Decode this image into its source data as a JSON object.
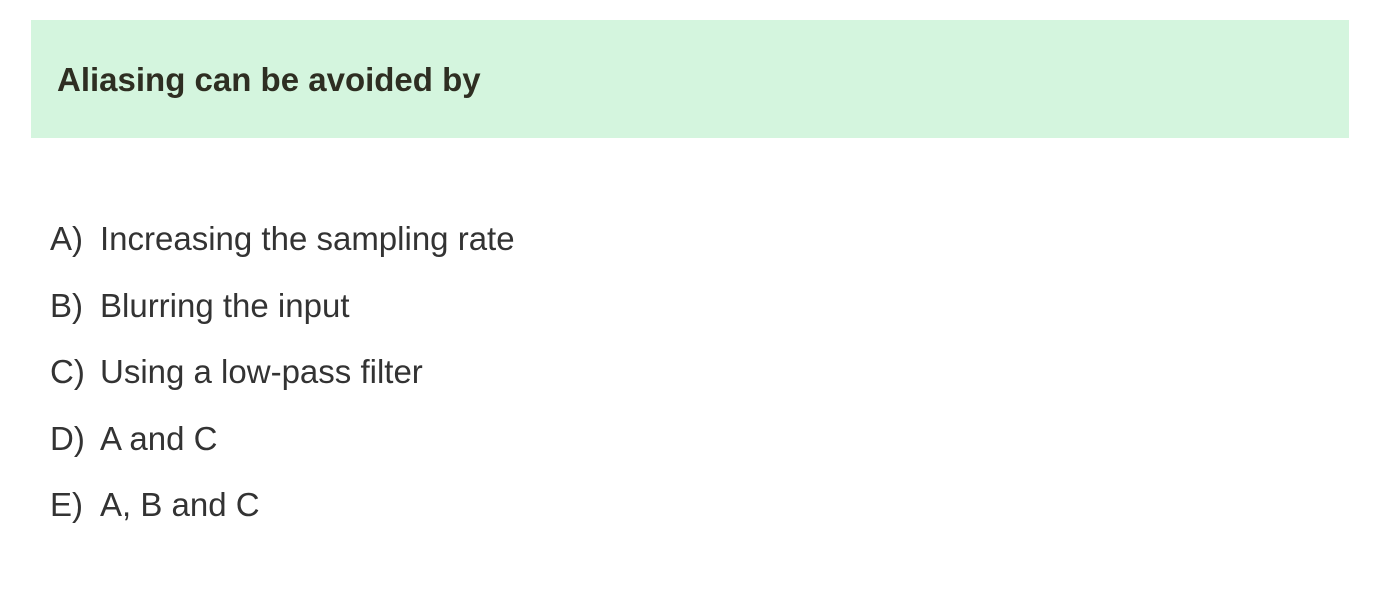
{
  "question": {
    "title": "Aliasing can be avoided by"
  },
  "options": [
    {
      "letter": "A)",
      "text": "Increasing the sampling rate"
    },
    {
      "letter": "B)",
      "text": "Blurring the input"
    },
    {
      "letter": "C)",
      "text": "Using a low-pass filter"
    },
    {
      "letter": "D)",
      "text": "A and C"
    },
    {
      "letter": "E)",
      "text": "A, B and C"
    }
  ],
  "colors": {
    "banner_background": "#d4f5de",
    "title_text": "#2e2e22",
    "option_text": "#333333",
    "page_background": "#ffffff"
  }
}
